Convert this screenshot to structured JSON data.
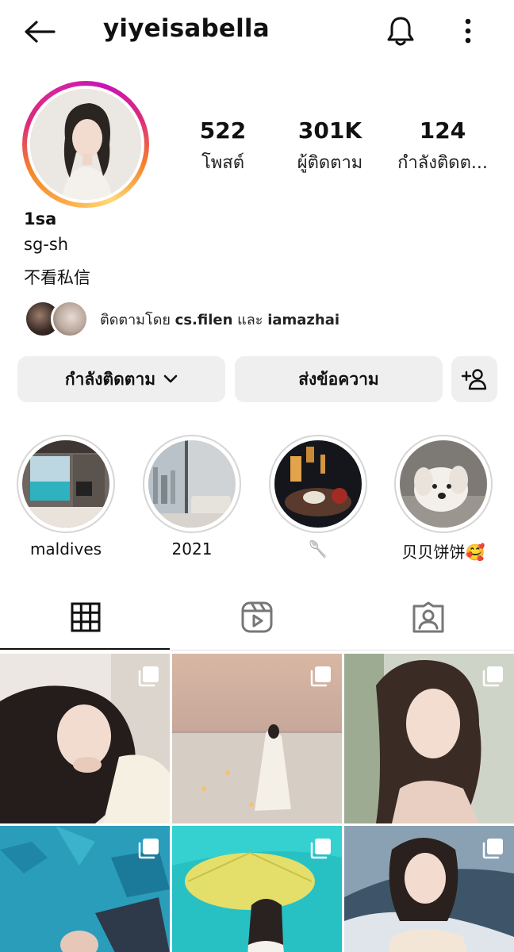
{
  "header": {
    "username": "yiyeisabella",
    "back_icon": "arrow-left-icon",
    "bell_icon": "bell-icon",
    "more_icon": "more-vertical-icon"
  },
  "profile": {
    "stats": [
      {
        "value": "522",
        "label": "โพสต์"
      },
      {
        "value": "301K",
        "label": "ผู้ติดตาม"
      },
      {
        "value": "124",
        "label": "กำลังติดต..."
      }
    ],
    "display_name": "1sa",
    "bio": [
      "sg-sh",
      "不看私信"
    ],
    "mutual": {
      "prefix": "ติดตามโดย ",
      "user1": "cs.filen",
      "joiner": " และ ",
      "user2": "iamazhai"
    }
  },
  "actions": {
    "following_label": "กำลังติดตาม",
    "message_label": "ส่งข้อความ",
    "add_icon": "add-person-icon"
  },
  "highlights": [
    {
      "label": "maldives"
    },
    {
      "label": "2021"
    },
    {
      "label": "🥄"
    },
    {
      "label": "贝贝饼饼🥰"
    }
  ],
  "tabs": [
    {
      "icon": "grid-icon",
      "selected": true
    },
    {
      "icon": "reels-icon",
      "selected": false
    },
    {
      "icon": "tagged-icon",
      "selected": false
    }
  ],
  "colors": {
    "button_bg": "#efefef",
    "story_ring_start": "#f58529",
    "story_ring_end": "#c913b9"
  }
}
